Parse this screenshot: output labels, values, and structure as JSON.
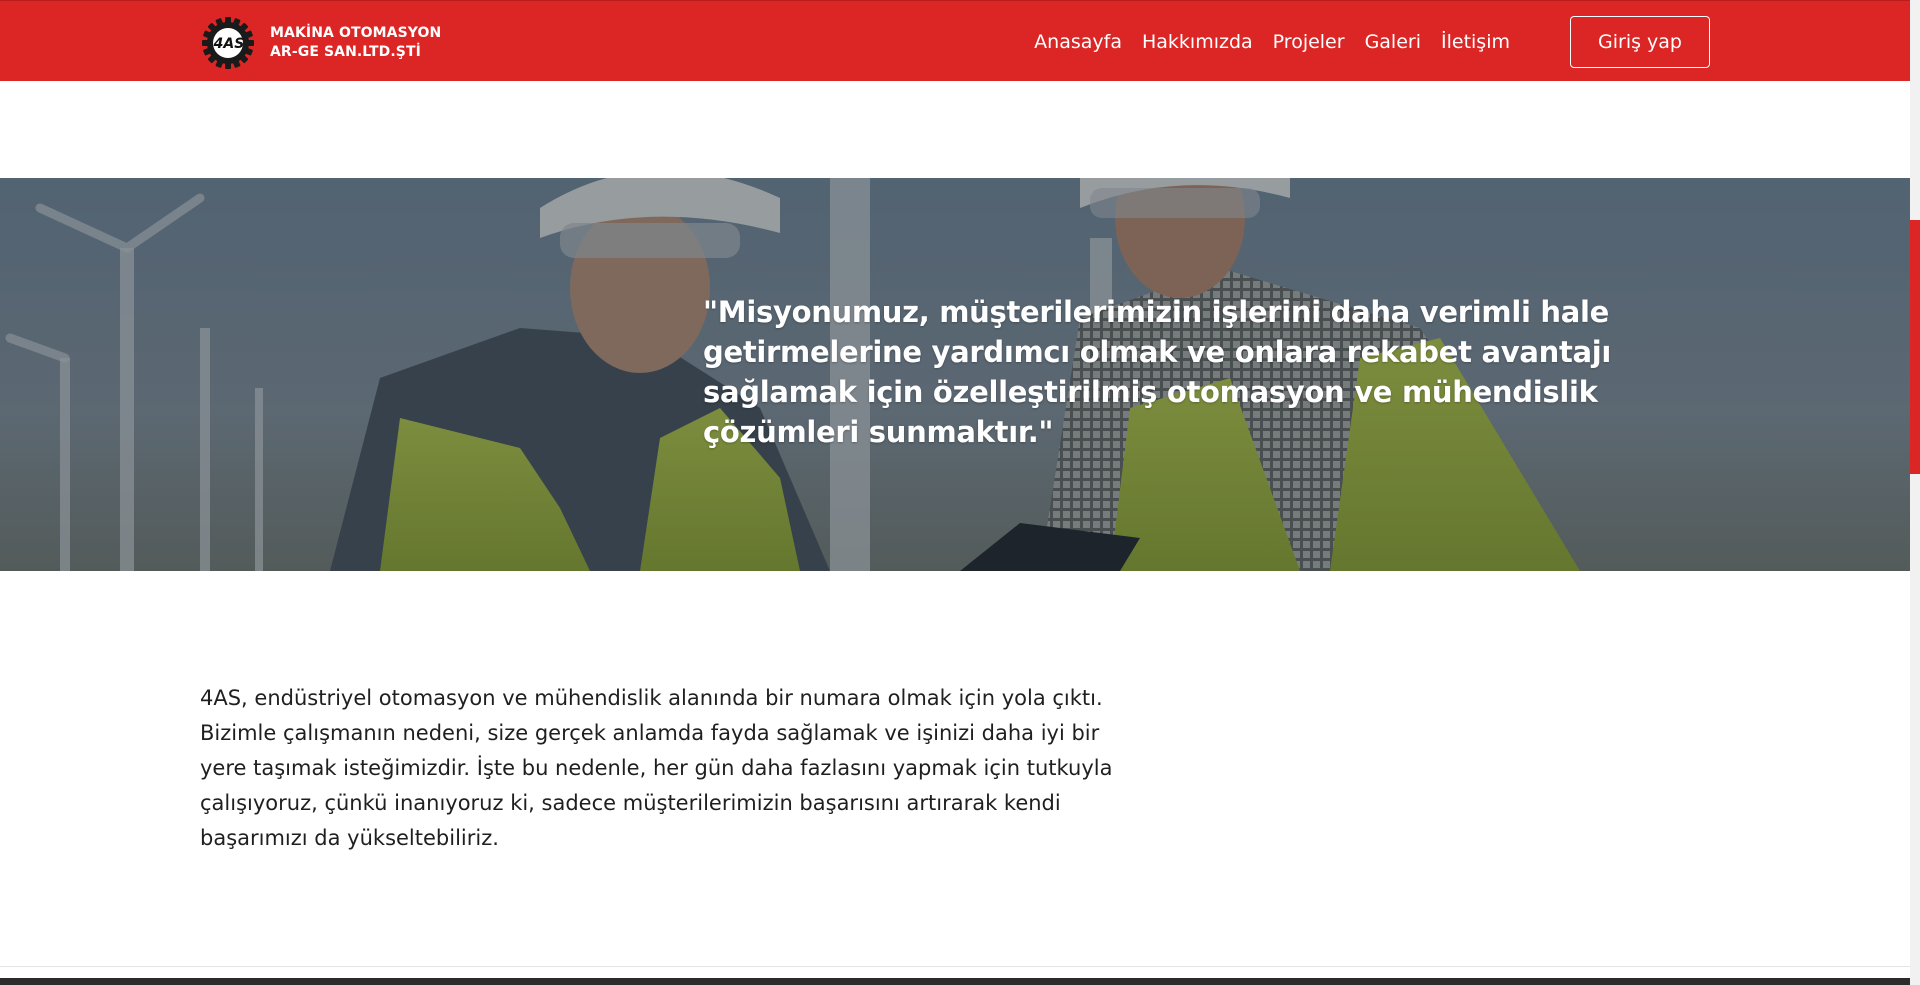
{
  "header": {
    "logo_text": "4AS",
    "company_line1": "MAKİNA OTOMASYON",
    "company_line2": "AR-GE SAN.LTD.ŞTİ",
    "nav": [
      {
        "label": "Anasayfa"
      },
      {
        "label": "Hakkımızda"
      },
      {
        "label": "Projeler"
      },
      {
        "label": "Galeri"
      },
      {
        "label": "İletişim"
      }
    ],
    "login_label": "Giriş yap"
  },
  "hero": {
    "quote_lines": [
      "\"Misyonumuz, müşterilerimizin işlerini daha verimli hale",
      "getirmelerine yardımcı olmak ve onlara rekabet avantajı",
      "sağlamak için özelleştirilmiş otomasyon ve mühendislik",
      "çözümleri sunmaktır.\""
    ]
  },
  "about": {
    "lines": [
      "4AS, endüstriyel otomasyon ve mühendislik alanında bir numara olmak için yola çıktı.",
      "Bizimle çalışmanın nedeni, size gerçek anlamda fayda sağlamak ve işinizi daha iyi bir",
      "yere taşımak isteğimizdir. İşte bu nedenle, her gün daha fazlasını yapmak için tutkuyla",
      "çalışıyoruz, çünkü inanıyoruz ki, sadece müşterilerimizin başarısını artırarak kendi",
      "başarımızı da yükseltebiliriz."
    ]
  },
  "colors": {
    "brand_red": "#dc2626",
    "text_dark": "#1f1f1f",
    "white": "#ffffff"
  },
  "icons": {
    "logo": "gear-logo-icon"
  }
}
